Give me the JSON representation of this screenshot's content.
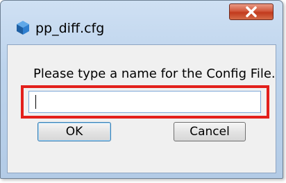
{
  "window": {
    "title": "pp_diff.cfg",
    "close_label": "X"
  },
  "dialog": {
    "prompt": "Please type a name for the Config File.",
    "input_value": "",
    "ok_label": "OK",
    "cancel_label": "Cancel"
  },
  "colors": {
    "highlight": "#e3201b",
    "titlebar": "#bcd3ec",
    "close_button": "#c23a1d"
  },
  "icons": [
    "cube-icon",
    "close-icon"
  ]
}
